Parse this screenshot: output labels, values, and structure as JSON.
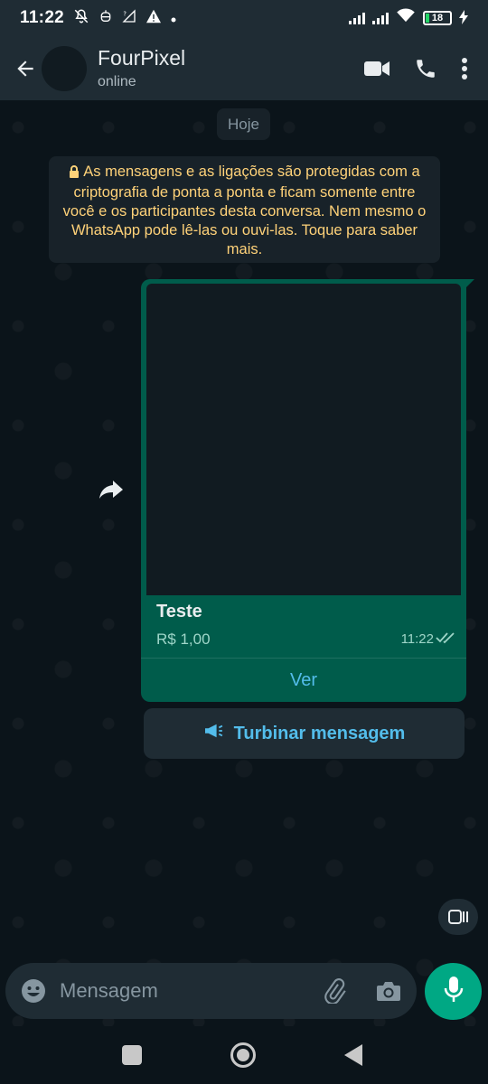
{
  "status_bar": {
    "time": "11:22",
    "battery_level": "18"
  },
  "header": {
    "contact_name": "FourPixel",
    "contact_status": "online"
  },
  "chat": {
    "date_chip": "Hoje",
    "encryption_notice": "As mensagens e as ligações são protegidas com a criptografia de ponta a ponta e ficam somente entre você e os participantes desta conversa. Nem mesmo o WhatsApp pode lê-las ou ouvi-las. Toque para saber mais.",
    "product_message": {
      "name": "Teste",
      "price": "R$ 1,00",
      "time": "11:22",
      "view_label": "Ver"
    },
    "boost_label": "Turbinar mensagem"
  },
  "composer": {
    "placeholder": "Mensagem"
  },
  "colors": {
    "header_bg": "#1f2c34",
    "chat_bg": "#0b141a",
    "outgoing_bubble": "#005c4b",
    "accent_green": "#00a884",
    "link_blue": "#53bdeb",
    "notice_text": "#ffd279"
  },
  "icons": {
    "status": [
      "mute-icon",
      "alarm-icon",
      "no-data-icon",
      "warning-icon",
      "dot-icon",
      "signal-icon",
      "signal-icon",
      "wifi-icon",
      "battery-icon",
      "charging-icon"
    ],
    "header": [
      "back-arrow-icon",
      "video-call-icon",
      "phone-icon",
      "more-vert-icon"
    ],
    "composer": [
      "emoji-icon",
      "attach-icon",
      "camera-icon",
      "mic-icon"
    ]
  }
}
